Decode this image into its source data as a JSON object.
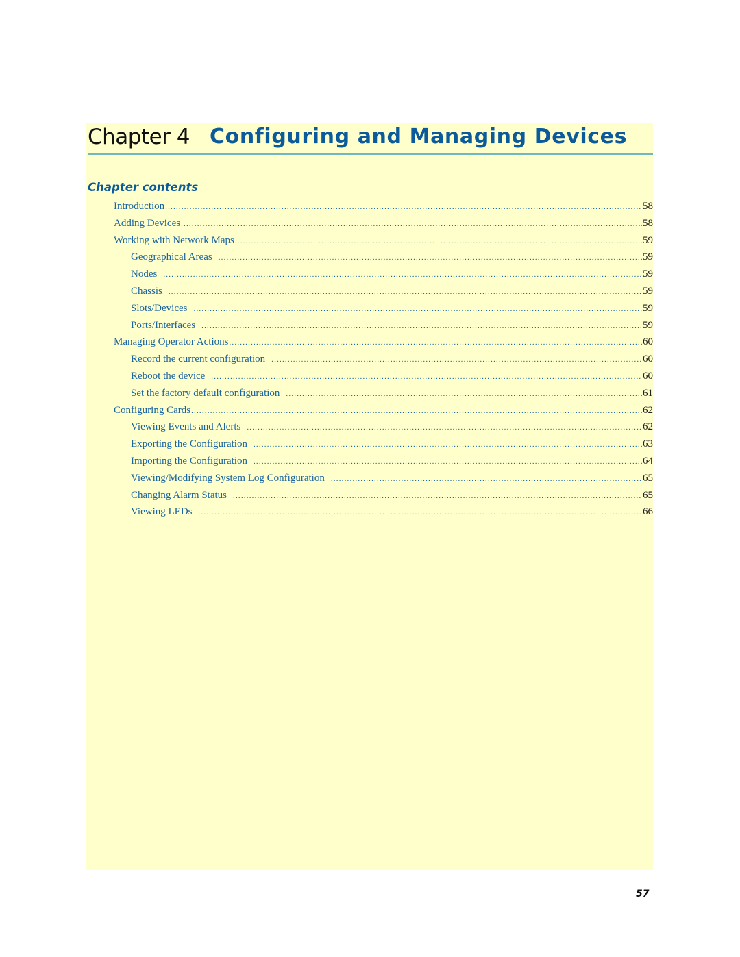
{
  "chapter": {
    "label": "Chapter 4",
    "title": "Configuring and Managing Devices"
  },
  "contents_heading": "Chapter contents",
  "toc": [
    {
      "title": "Introduction",
      "page": "58",
      "level": 1
    },
    {
      "title": "Adding Devices",
      "page": "58",
      "level": 1
    },
    {
      "title": "Working with Network Maps",
      "page": "59",
      "level": 1
    },
    {
      "title": "Geographical Areas",
      "page": "59",
      "level": 2
    },
    {
      "title": "Nodes",
      "page": "59",
      "level": 2
    },
    {
      "title": "Chassis",
      "page": "59",
      "level": 2
    },
    {
      "title": "Slots/Devices",
      "page": "59",
      "level": 2
    },
    {
      "title": "Ports/Interfaces",
      "page": "59",
      "level": 2
    },
    {
      "title": "Managing Operator Actions",
      "page": "60",
      "level": 1
    },
    {
      "title": "Record the current configuration",
      "page": "60",
      "level": 2
    },
    {
      "title": "Reboot the device",
      "page": "60",
      "level": 2
    },
    {
      "title": "Set the factory default configuration",
      "page": "61",
      "level": 2
    },
    {
      "title": "Configuring Cards",
      "page": "62",
      "level": 1
    },
    {
      "title": "Viewing Events and Alerts",
      "page": "62",
      "level": 2
    },
    {
      "title": "Exporting the Configuration",
      "page": "63",
      "level": 2
    },
    {
      "title": "Importing the Configuration",
      "page": "64",
      "level": 2
    },
    {
      "title": "Viewing/Modifying System Log Configuration",
      "page": "65",
      "level": 2
    },
    {
      "title": "Changing Alarm Status",
      "page": "65",
      "level": 2
    },
    {
      "title": "Viewing LEDs",
      "page": "66",
      "level": 2
    }
  ],
  "page_number": "57",
  "colors": {
    "panel_background": "#ffffcc",
    "title_blue": "#0a5a9c",
    "link_blue": "#1a64a0",
    "rule_teal": "#6fb8c0"
  }
}
